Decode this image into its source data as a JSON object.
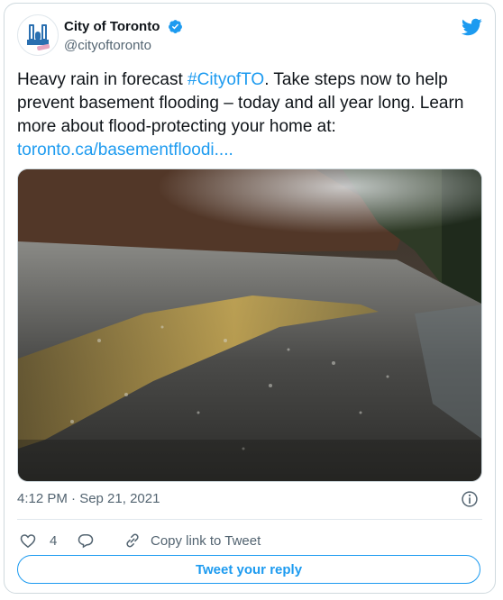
{
  "account": {
    "display_name": "City of Toronto",
    "handle": "@cityoftoronto",
    "avatar_badge_text": "TORONTO",
    "verified_icon": "verified-badge-icon"
  },
  "tweet": {
    "text_before": "Heavy rain in forecast ",
    "hashtag": "#CityofTO",
    "text_after": ". Take steps now to help prevent basement flooding – today and all year long. Learn more about flood-protecting your home at: ",
    "url": "toronto.ca/basementfloodi....",
    "media_alt": "Rain falling on a wet road with a yellow center line",
    "timestamp": "4:12 PM · Sep 21, 2021"
  },
  "actions": {
    "like_count": "4",
    "copy_link_label": "Copy link to Tweet",
    "reply_cta": "Tweet your reply"
  },
  "colors": {
    "accent": "#1d9bf0",
    "text": "#0f1419",
    "muted": "#536471",
    "border": "#cfd9de"
  }
}
